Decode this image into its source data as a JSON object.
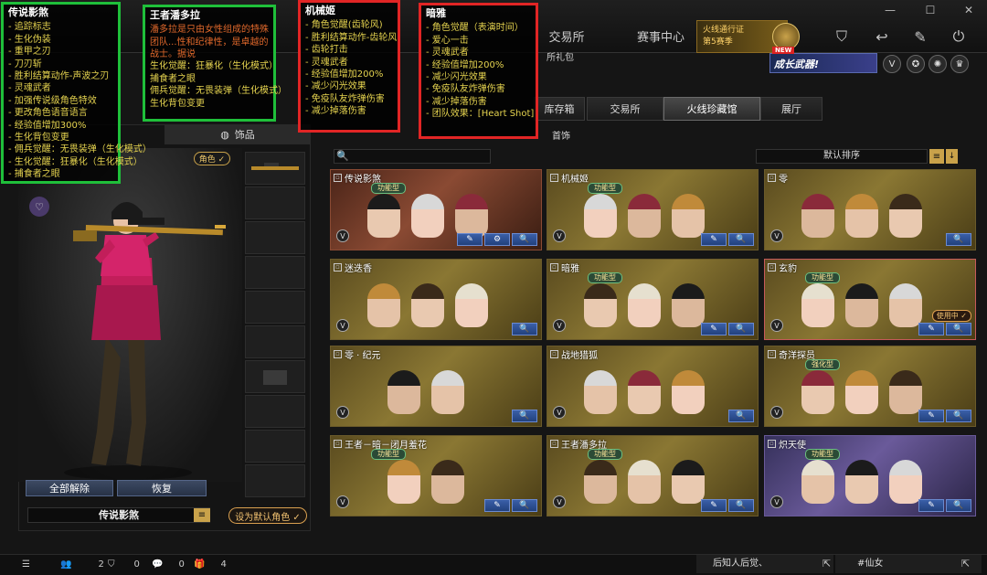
{
  "topbar": {
    "tabs": [
      "交易所",
      "赛事中心"
    ],
    "promo_lines": [
      "火线通行证",
      "第5赛季"
    ],
    "growth_banner": "成长武器!",
    "growth_new": "NEW",
    "window_controls": [
      "—",
      "☐",
      "✕"
    ]
  },
  "shop_gift": "所礼包",
  "subtabs": [
    "库存箱",
    "交易所",
    "火线珍藏馆",
    "展厅"
  ],
  "left": {
    "accessory_tab": "饰品",
    "role_badge": "角色 ✓",
    "reset_all": "全部解除",
    "restore": "恢复",
    "current_name": "传说影煞",
    "set_default": "设为默认角色 ✓"
  },
  "grid_header": {
    "category": "首饰",
    "sort_label": "默认排序"
  },
  "notes": {
    "legend": {
      "title": "传说影煞",
      "lines": [
        "- 追踪标志",
        "- 生化伪装",
        "- 重甲之刃",
        "- 刀刃斩",
        "- 胜利结算动作-声波之刃",
        "- 灵魂武者",
        "- 加强传说级角色特效",
        "- 更改角色语音语言",
        "- 经验值增加300%",
        "- 生化背包变更",
        "- 佣兵觉醒：无畏装弹（生化模式）",
        "- 生化觉醒：狂暴化（生化模式）",
        "- 捕食者之眼"
      ]
    },
    "king": {
      "title": "王者潘多拉",
      "para": "潘多拉是只由女性组成的特殊团队...性和纪律性，是卓越的战士。据说",
      "lines": [
        "生化觉醒：狂暴化（生化模式）",
        "捕食者之眼",
        "佣兵觉醒：无畏装弹（生化模式）",
        "生化背包变更"
      ]
    },
    "mech": {
      "title": "机械姬",
      "lines": [
        "- 角色觉醒(齿轮风)",
        "- 胜利结算动作-齿轮风",
        "- 齿轮打击",
        "- 灵魂武者",
        "- 经验值增加200%",
        "- 减少闪光效果",
        "- 免疫队友炸弹伤害",
        "- 减少掉落伤害"
      ]
    },
    "dark": {
      "title": "暗雅",
      "lines": [
        "- 角色觉醒（表演时间）",
        "- 爱心一击",
        "- 灵魂武者",
        "- 经验值增加200%",
        "- 减少闪光效果",
        "- 免疫队友炸弹伤害",
        "- 减少掉落伤害",
        "- 团队效果：[Heart Shot]"
      ]
    }
  },
  "cards": [
    {
      "name": "传说影煞",
      "tag": "功能型",
      "buttons": [
        "✎",
        "⚙",
        "🔍"
      ]
    },
    {
      "name": "机械姬",
      "tag": "功能型",
      "buttons": [
        "✎",
        "🔍"
      ]
    },
    {
      "name": "零",
      "tag": "",
      "buttons": [
        "🔍"
      ]
    },
    {
      "name": "迷迭香",
      "tag": "",
      "buttons": [
        "🔍"
      ]
    },
    {
      "name": "暗雅",
      "tag": "功能型",
      "buttons": [
        "✎",
        "🔍"
      ]
    },
    {
      "name": "玄豹",
      "tag": "功能型",
      "buttons": [
        "✎",
        "🔍"
      ],
      "in_use": "使用中 ✓"
    },
    {
      "name": "零 · 纪元",
      "tag": "",
      "buttons": [
        "🔍"
      ]
    },
    {
      "name": "战地猎狐",
      "tag": "",
      "buttons": [
        "🔍"
      ]
    },
    {
      "name": "奇洋探员",
      "tag": "强化型",
      "buttons": [
        "✎",
        "🔍"
      ]
    },
    {
      "name": "王者－暗－闭月羞花",
      "tag": "功能型",
      "buttons": [
        "✎",
        "🔍"
      ]
    },
    {
      "name": "王者潘多拉",
      "tag": "功能型",
      "buttons": [
        "✎",
        "🔍"
      ]
    },
    {
      "name": "炽天使",
      "tag": "功能型",
      "buttons": [
        "✎",
        "🔍"
      ]
    }
  ],
  "bottom": {
    "count_a": "2",
    "count_b": "0",
    "count_c": "0",
    "count_d": "4",
    "ticker1": "后知人后觉、",
    "ticker2": "#仙女"
  },
  "colors": {
    "accent_gold": "#c9a24a",
    "note_green": "#1fbf3a",
    "note_red": "#e12525"
  }
}
